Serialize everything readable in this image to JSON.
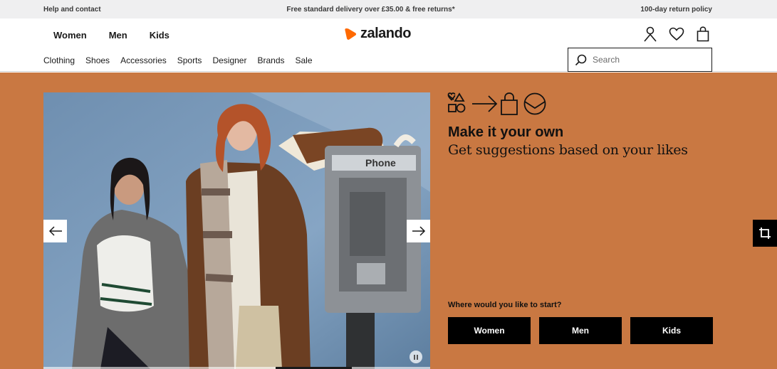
{
  "topbar": {
    "help": "Help and contact",
    "delivery": "Free standard delivery over £35.00 & free returns*",
    "returns": "100-day return policy"
  },
  "header": {
    "gender_tabs": [
      "Women",
      "Men",
      "Kids"
    ],
    "logo_text": "zalando",
    "icons": [
      "user-icon",
      "heart-icon",
      "bag-icon"
    ],
    "brand_color": "#ff6900"
  },
  "nav": {
    "categories": [
      "Clothing",
      "Shoes",
      "Accessories",
      "Sports",
      "Designer",
      "Brands",
      "Sale"
    ],
    "search_placeholder": "Search"
  },
  "hero": {
    "background": "#c97842",
    "title": "Make it your own",
    "subtitle": "Get suggestions based on your likes",
    "question": "Where would you like to start?",
    "buttons": [
      "Women",
      "Men",
      "Kids"
    ],
    "photo_sign_text": "Phone",
    "carousel_controls": [
      "arrow-left-icon",
      "arrow-right-icon",
      "pause-icon"
    ]
  }
}
